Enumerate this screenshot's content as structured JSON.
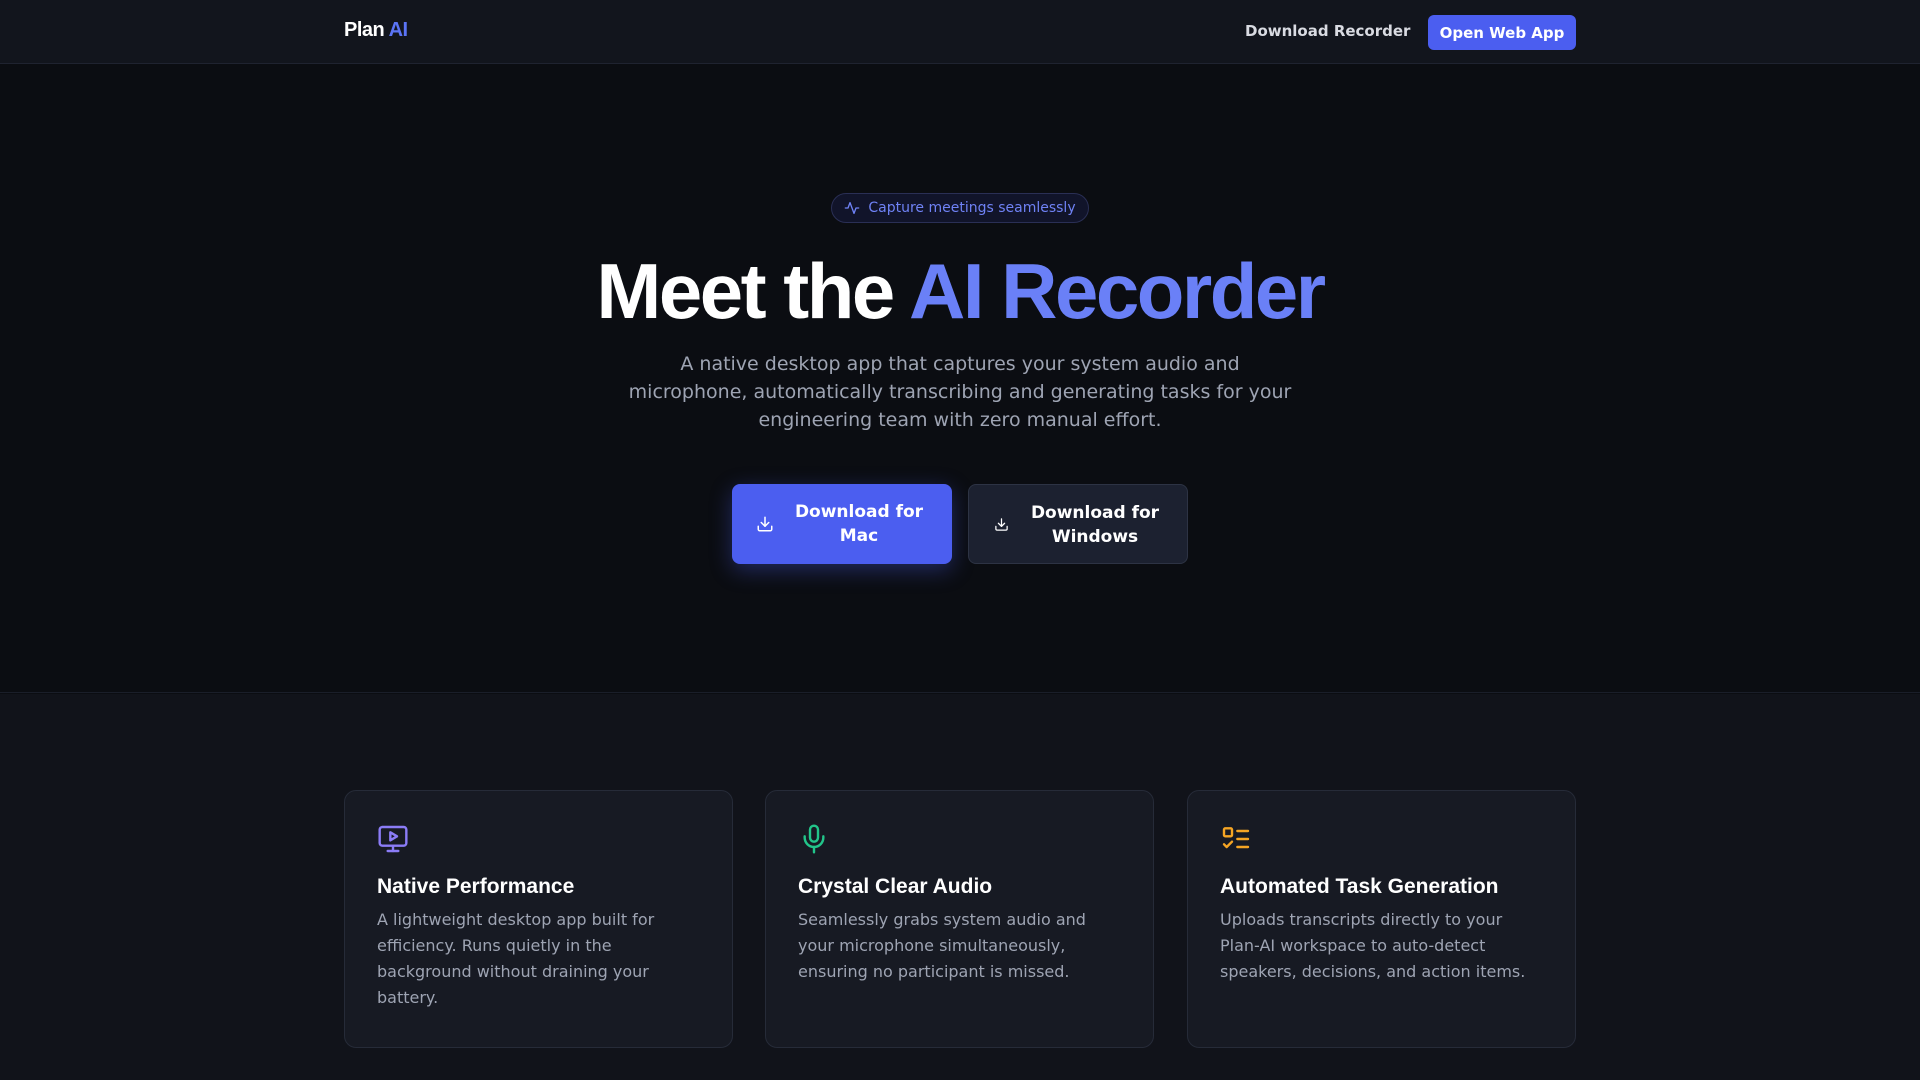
{
  "nav": {
    "logo_main": "Plan",
    "logo_accent": "AI",
    "download_link": "Download Recorder",
    "open_app": "Open Web App"
  },
  "hero": {
    "badge": "Capture meetings seamlessly",
    "title_main": "Meet the ",
    "title_accent": "AI Recorder",
    "subtitle": "A native desktop app that captures your system audio and microphone, automatically transcribing and generating tasks for your engineering team with zero manual effort.",
    "download_mac": "Download for Mac",
    "download_windows": "Download for Windows"
  },
  "features": [
    {
      "icon": "monitor-play-icon",
      "title": "Native Performance",
      "description": "A lightweight desktop app built for efficiency. Runs quietly in the background without draining your battery.",
      "color": "#8b7cf6"
    },
    {
      "icon": "microphone-icon",
      "title": "Crystal Clear Audio",
      "description": "Seamlessly grabs system audio and your microphone simultaneously, ensuring no participant is missed.",
      "color": "#22c58a"
    },
    {
      "icon": "task-list-icon",
      "title": "Automated Task Generation",
      "description": "Uploads transcripts directly to your Plan-AI workspace to auto-detect speakers, decisions, and action items.",
      "color": "#f5a524"
    }
  ],
  "colors": {
    "primary": "#4b5ef0",
    "accent_text": "#6a80f7",
    "background": "#0b0d12"
  }
}
